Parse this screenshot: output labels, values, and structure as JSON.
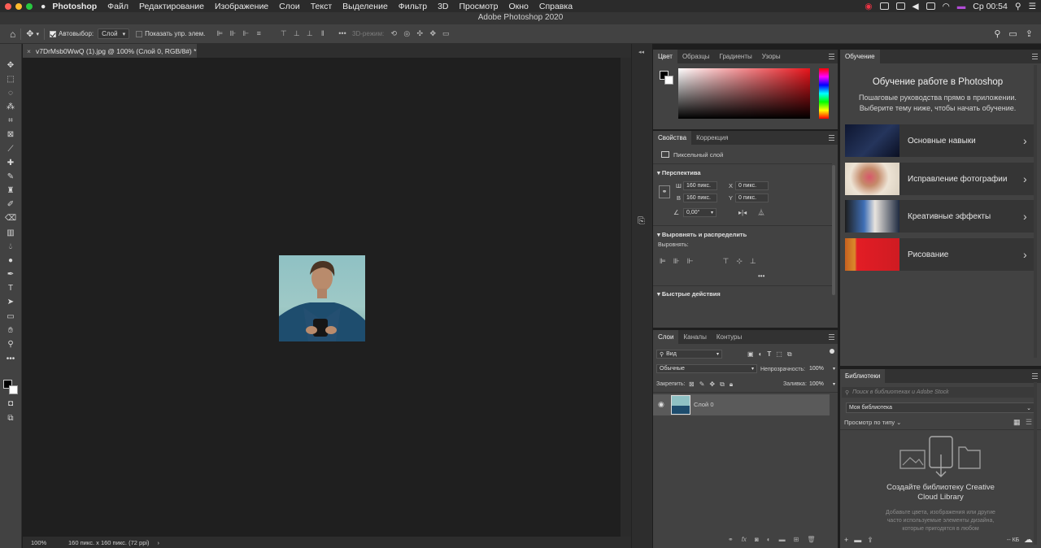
{
  "menubar": {
    "app_name": "Photoshop",
    "items": [
      "Файл",
      "Редактирование",
      "Изображение",
      "Слои",
      "Текст",
      "Выделение",
      "Фильтр",
      "3D",
      "Просмотр",
      "Окно",
      "Справка"
    ],
    "window_title": "Adobe Photoshop 2020",
    "clock": "Ср 00:54",
    "colors": {
      "close": "#fe5f57",
      "minimize": "#febc2e",
      "zoom": "#28c840"
    }
  },
  "options_bar": {
    "autoselect_label": "Автовыбор:",
    "autoselect_value": "Слой",
    "show_transform_label": "Показать упр. элем.",
    "mode3d_label": "3D-режим:"
  },
  "document": {
    "tab_title": "v7DrMsb0WwQ (1).jpg @ 100% (Слой 0, RGB/8#) *",
    "zoom": "100%",
    "doc_info": "160 пикс. x 160 пикс. (72 ppi)"
  },
  "color_panel": {
    "tabs": [
      "Цвет",
      "Образцы",
      "Градиенты",
      "Узоры"
    ],
    "hue_color": "#e8141b"
  },
  "properties_panel": {
    "tabs": [
      "Свойства",
      "Коррекция"
    ],
    "layer_kind": "Пиксельный слой",
    "perspective_title": "Перспектива",
    "w_label": "Ш",
    "w_value": "160 пикс.",
    "h_label": "В",
    "h_value": "160 пикс.",
    "x_label": "X",
    "x_value": "0 пикс.",
    "y_label": "Y",
    "y_value": "0 пикс.",
    "angle_value": "0,00°",
    "align_title": "Выровнять и распределить",
    "align_label": "Выровнять:",
    "more": "•••",
    "quick_actions_title": "Быстрые действия"
  },
  "layers_panel": {
    "tabs": [
      "Слои",
      "Каналы",
      "Контуры"
    ],
    "filter_value": "Вид",
    "blend_mode": "Обычные",
    "opacity_label": "Непрозрачность:",
    "opacity_value": "100%",
    "lock_label": "Закрепить:",
    "fill_label": "Заливка:",
    "fill_value": "100%",
    "layers": [
      {
        "name": "Слой 0"
      }
    ]
  },
  "learn_panel": {
    "tab": "Обучение",
    "title": "Обучение работе в Photoshop",
    "subtitle_line1": "Пошаговые руководства прямо в приложении.",
    "subtitle_line2": "Выберите тему ниже, чтобы начать обучение.",
    "items": [
      {
        "label": "Основные навыки"
      },
      {
        "label": "Исправление фотографии"
      },
      {
        "label": "Креативные эффекты"
      },
      {
        "label": "Рисование"
      }
    ]
  },
  "libraries_panel": {
    "tab": "Библиотеки",
    "search_placeholder": "Поиск в библиотеках и Adobe Stock",
    "library_name": "Моя библиотека",
    "view_by": "Просмотр по типу",
    "empty_title_line1": "Создайте библиотеку Creative",
    "empty_title_line2": "Cloud Library",
    "empty_desc_line1": "Добавьте цвета, изображения или другие",
    "empty_desc_line2": "часто используемые элементы дизайна,",
    "empty_desc_line3": "которые пригодятся в любом",
    "size_label": "-- КБ"
  }
}
